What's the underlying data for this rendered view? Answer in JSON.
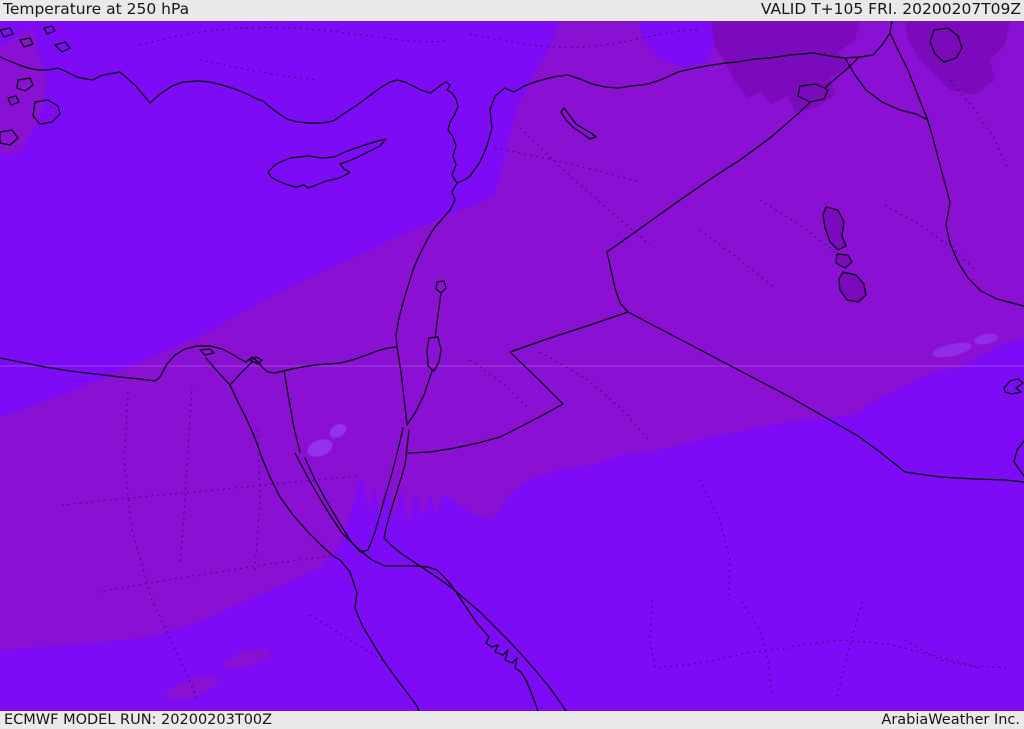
{
  "header": {
    "title": "Temperature at 250 hPa",
    "valid": "VALID T+105 FRI. 20200207T09Z"
  },
  "footer": {
    "model_run": "ECMWF MODEL RUN: 20200203T00Z",
    "credit": "ArabiaWeather Inc."
  },
  "map": {
    "colors": {
      "bright": "#7d0bf6",
      "medium": "#8a10d4",
      "dark": "#7a0abb",
      "light": "#9339ee",
      "outline": "#000000",
      "dotted": "#140322",
      "graticule": "#ffffff",
      "bar_bg": "#e9e9e9",
      "bar_text": "#161616"
    }
  }
}
